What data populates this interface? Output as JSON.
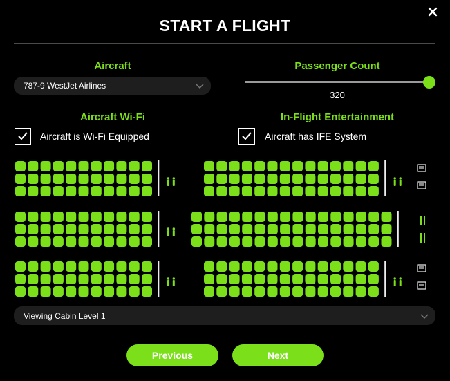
{
  "dialog": {
    "title": "START A FLIGHT"
  },
  "aircraft": {
    "heading": "Aircraft",
    "selected": "787-9 WestJet Airlines"
  },
  "passengers": {
    "heading": "Passenger Count",
    "value": "320",
    "slider_fraction": 1.0
  },
  "wifi": {
    "heading": "Aircraft Wi-Fi",
    "checkbox_label": "Aircraft is Wi-Fi Equipped",
    "checked": true
  },
  "ife": {
    "heading": "In-Flight Entertainment",
    "checkbox_label": "Aircraft has IFE System",
    "checked": true
  },
  "cabin": {
    "selected": "Viewing Cabin Level 1"
  },
  "buttons": {
    "previous": "Previous",
    "next": "Next"
  },
  "icons": {
    "close": "close-icon",
    "dropdown": "chevron-down-icon",
    "check": "checkmark-icon",
    "seat": "seat-icon",
    "lavatory": "restroom-icon",
    "galley": "galley-icon",
    "gate": "galley-cart-icon"
  },
  "colors": {
    "accent": "#7be01a",
    "background": "#000000",
    "field": "#1e1e1e"
  },
  "seat_map": {
    "rows": [
      {
        "blocks": [
          {
            "columns": 11,
            "rows": 3
          },
          {
            "columns": 14,
            "rows": 3
          }
        ],
        "amenities": [
          "lavatory",
          "lavatory",
          "galley"
        ]
      },
      {
        "blocks": [
          {
            "columns": 11,
            "rows": 3
          },
          {
            "columns": 16,
            "rows": 3
          }
        ],
        "amenities": [
          "lavatory",
          "galley-cart"
        ]
      },
      {
        "blocks": [
          {
            "columns": 11,
            "rows": 3
          },
          {
            "columns": 14,
            "rows": 3
          }
        ],
        "amenities": [
          "lavatory",
          "lavatory",
          "galley"
        ]
      }
    ]
  }
}
